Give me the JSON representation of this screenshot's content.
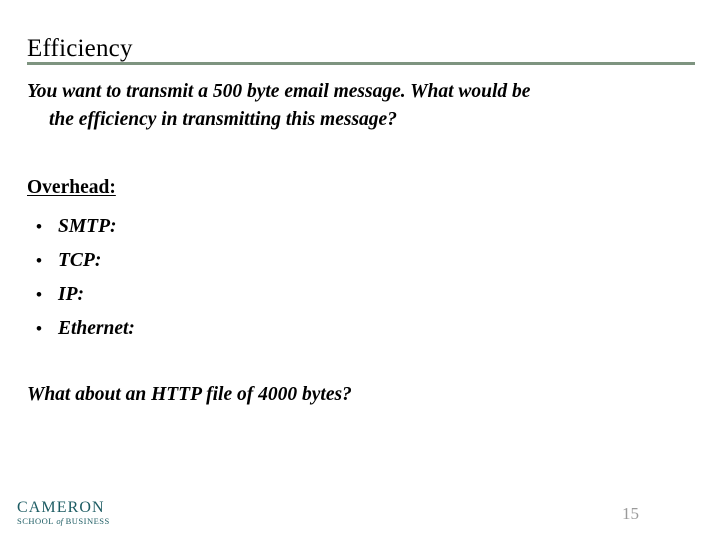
{
  "slide": {
    "title": "Efficiency",
    "accent_rule_color": "#7e9480",
    "background_color": "#ffffff",
    "text_color": "#000000",
    "intro": {
      "line1": "You want to transmit a 500 byte email message.   What would be",
      "line2": "the efficiency in transmitting this message?"
    },
    "overhead": {
      "heading": "Overhead:",
      "bullet_glyph": "•",
      "items": [
        {
          "label": "SMTP:"
        },
        {
          "label": "TCP:"
        },
        {
          "label": "IP:"
        },
        {
          "label": "Ethernet:"
        }
      ]
    },
    "closing_question": "What about an HTTP file of 4000 bytes?",
    "footer": {
      "logo_main": "CAMERON",
      "logo_sub_school": "SCHOOL",
      "logo_sub_of": "of",
      "logo_sub_business": "BUSINESS",
      "logo_color": "#1d5c63",
      "page_number": "15",
      "page_number_color": "#9a9a9a"
    }
  }
}
